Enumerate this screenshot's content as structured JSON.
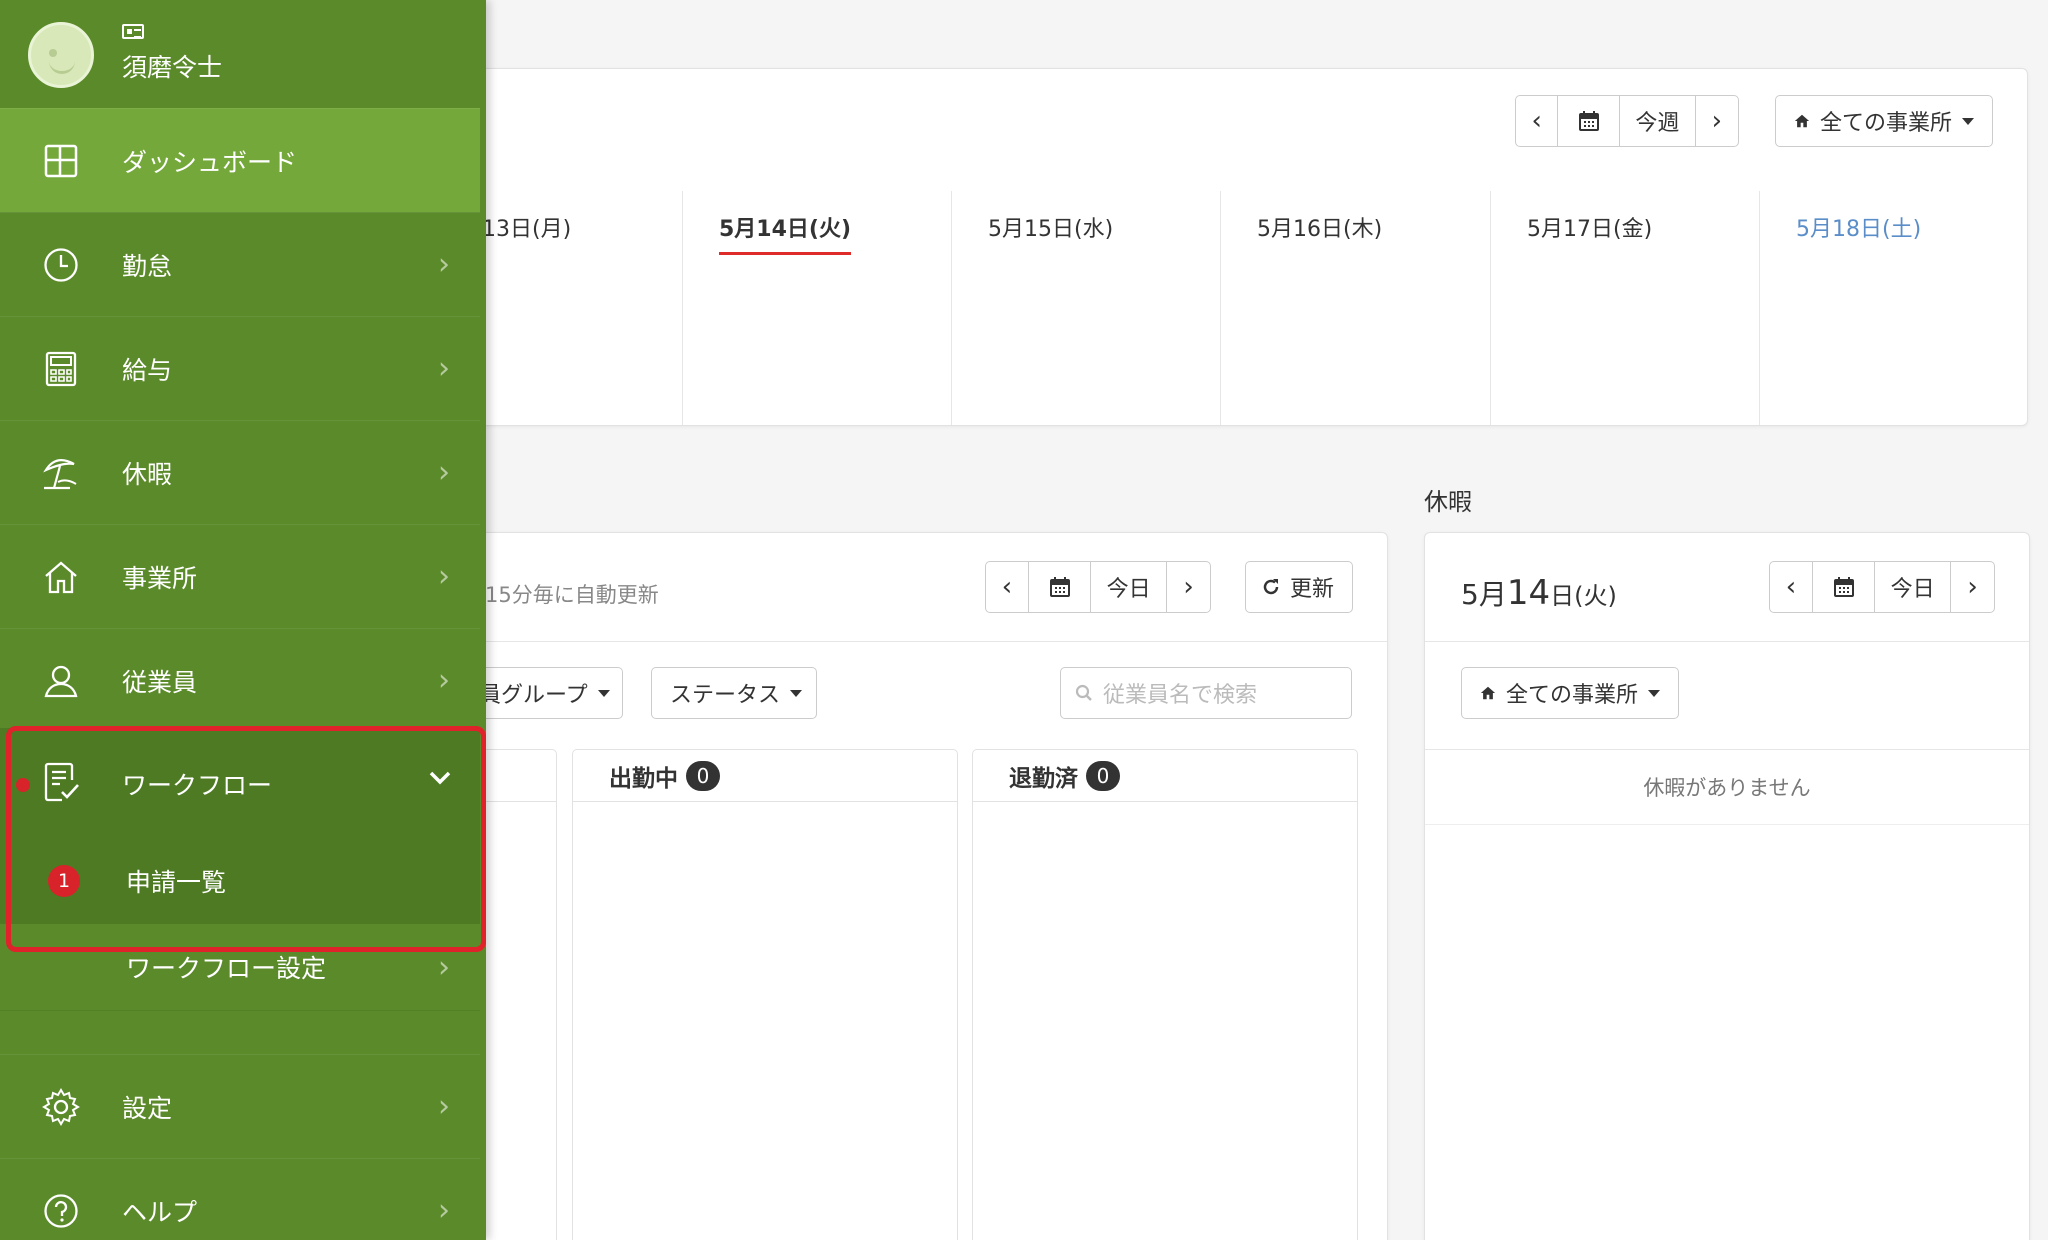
{
  "user": {
    "name": "須磨令士"
  },
  "sidebar": {
    "dashboard": "ダッシュボード",
    "items": [
      {
        "label": "勤怠",
        "icon": "clock-icon"
      },
      {
        "label": "給与",
        "icon": "calculator-icon"
      },
      {
        "label": "休暇",
        "icon": "beach-umbrella-icon"
      },
      {
        "label": "事業所",
        "icon": "home-icon"
      },
      {
        "label": "従業員",
        "icon": "person-icon"
      }
    ],
    "workflow": {
      "label": "ワークフロー",
      "sub": [
        {
          "label": "申請一覧",
          "badge": "1"
        },
        {
          "label": "ワークフロー設定"
        }
      ]
    },
    "settings": "設定",
    "help": "ヘルプ"
  },
  "week": {
    "this_week": "今週",
    "office_filter": "全ての事業所",
    "days": [
      {
        "label": "13日(月)"
      },
      {
        "label": "5月14日(火)",
        "today": true
      },
      {
        "label": "5月15日(水)"
      },
      {
        "label": "5月16日(木)"
      },
      {
        "label": "5月17日(金)"
      },
      {
        "label": "5月18日(土)",
        "saturday": true
      }
    ]
  },
  "attendance": {
    "auto_refresh": "15分毎に自動更新",
    "today": "今日",
    "refresh": "更新",
    "group_filter": "業員グループ",
    "status_filter": "ステータス",
    "search_placeholder": "従業員名で検索",
    "columns": [
      {
        "label": "出勤中",
        "count": "0"
      },
      {
        "label": "退勤済",
        "count": "0"
      }
    ]
  },
  "leave": {
    "section_title": "休暇",
    "date_main": "5月",
    "date_day": "14",
    "date_suffix": "日(火)",
    "today": "今日",
    "office_filter": "全ての事業所",
    "empty": "休暇がありません"
  }
}
